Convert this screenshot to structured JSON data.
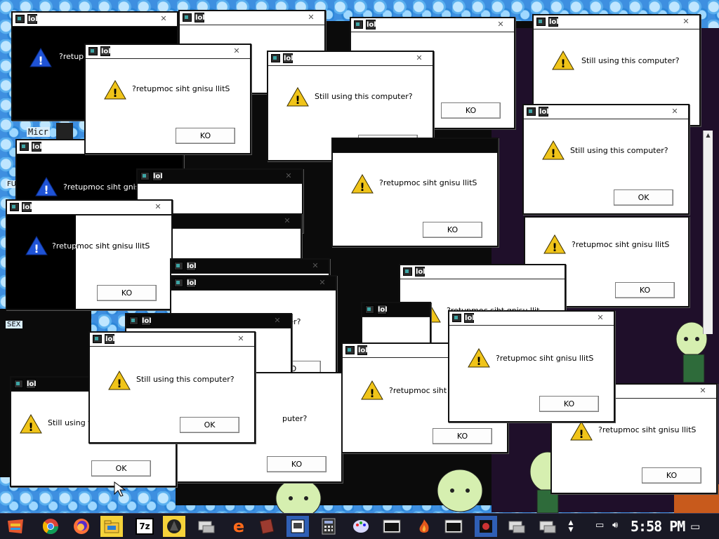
{
  "dialog": {
    "app_name": "lol",
    "close_glyph": "✕",
    "message": "Still using this computer?",
    "message_reversed": "?retupmoc siht gnisu llitS",
    "ok": "OK",
    "ok_reversed": "KO",
    "msg_partial_1": "?retup",
    "msg_partial_2": "?retupmoc siht gnisu",
    "msg_partial_3": "Still using t",
    "msg_partial_4": "?retupmoc siht",
    "msg_partial_5": "iter?",
    "msg_partial_6": "puter?",
    "msg_partial_7": "?retupmoc siht gnisu llit"
  },
  "desktop": {
    "labels": {
      "mic": "Micr",
      "fu": "FU",
      "sex": "SEX"
    },
    "icons": {
      "warning_blue": "warning-blue-icon",
      "warning_yellow": "warning-yellow-icon"
    }
  },
  "taskbar": {
    "clock": "5:58 PM",
    "items": [
      {
        "icon": "start-flag-icon"
      },
      {
        "icon": "chrome-icon"
      },
      {
        "icon": "firefox-icon"
      },
      {
        "icon": "file-explorer-icon"
      },
      {
        "icon": "7zip-icon",
        "text": "7z"
      },
      {
        "icon": "app-dark-icon"
      },
      {
        "icon": "remote-desktop-icon"
      },
      {
        "icon": "edge-icon"
      },
      {
        "icon": "book-icon"
      },
      {
        "icon": "media-icon"
      },
      {
        "icon": "calculator-icon"
      },
      {
        "icon": "paint-icon"
      },
      {
        "icon": "terminal-icon"
      },
      {
        "icon": "flame-app-icon"
      },
      {
        "icon": "terminal-icon-2"
      },
      {
        "icon": "game-icon"
      },
      {
        "icon": "network-app-icon"
      },
      {
        "icon": "network-app-icon-2"
      }
    ],
    "tray": {
      "network": "network-icon",
      "volume": "volume-icon",
      "notifications": "notifications-icon"
    }
  }
}
